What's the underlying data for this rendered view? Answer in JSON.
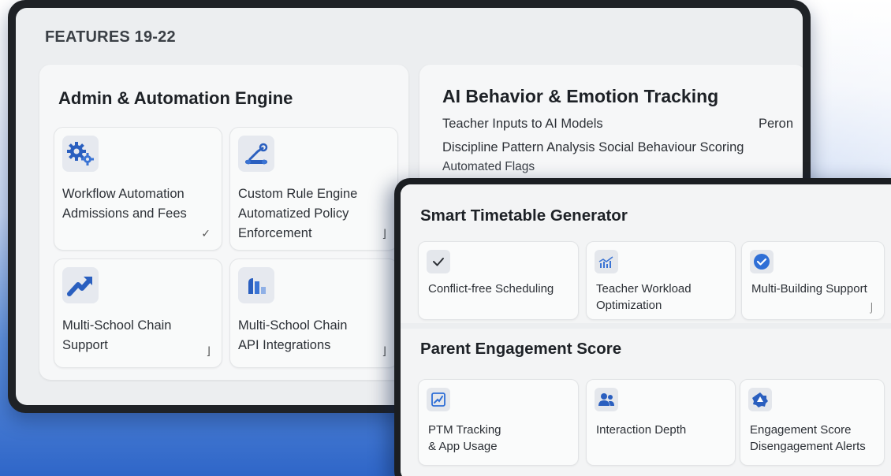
{
  "back_screen": {
    "title": "FEATURES 19-22",
    "admin_panel": {
      "title": "Admin & Automation Engine",
      "cards": [
        {
          "icon": "gears-icon",
          "line1": "Workflow Automation",
          "line2": "Admissions and Fees",
          "line3": "",
          "corner": "✓"
        },
        {
          "icon": "robot-arm-icon",
          "line1": "Custom Rule Engine",
          "line2": "Automatized Policy",
          "line3": "Enforcement",
          "corner": "⌋"
        },
        {
          "icon": "trend-arrow-icon",
          "line1": "Multi-School Chain",
          "line2": "Support",
          "line3": "",
          "corner": "⌋"
        },
        {
          "icon": "bar-chart-icon",
          "line1": "Multi-School Chain",
          "line2": "API Integrations",
          "line3": "",
          "corner": "⌋"
        }
      ]
    },
    "ai_panel": {
      "title": "AI Behavior & Emotion Tracking",
      "line1": "Teacher Inputs to AI Models",
      "line1_right": "Peron",
      "line2": "Discipline Pattern Analysis Social Behaviour Scoring",
      "line3": "Automated Flags"
    }
  },
  "front_screen": {
    "timetable": {
      "title": "Smart Timetable Generator",
      "cards": [
        {
          "icon": "check-icon",
          "line1": "Conflict-free Scheduling",
          "line2": "",
          "corner": ""
        },
        {
          "icon": "line-chart-icon",
          "line1": "Teacher Workload",
          "line2": "Optimization",
          "corner": ""
        },
        {
          "icon": "check-circle-icon",
          "line1": "Multi-Building Support",
          "line2": "",
          "corner": "⌡"
        }
      ]
    },
    "engagement": {
      "title": "Parent Engagement Score",
      "cards": [
        {
          "icon": "edit-chart-icon",
          "line1": "PTM Tracking",
          "line2": "& App Usage"
        },
        {
          "icon": "users-icon",
          "line1": "Interaction Depth",
          "line2": ""
        },
        {
          "icon": "alert-bell-icon",
          "line1": "Engagement Score",
          "line2": "Disengagement Alerts"
        }
      ]
    }
  },
  "colors": {
    "accent": "#2f6fd6",
    "icon_tile": "#e6e9ef",
    "frame": "#1f2226"
  }
}
